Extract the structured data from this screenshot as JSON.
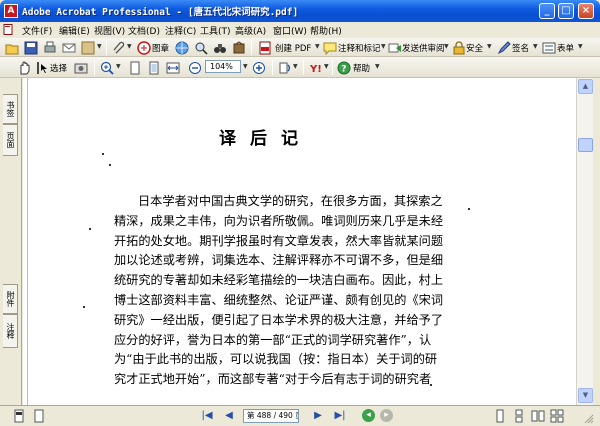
{
  "window": {
    "title": "Adobe Acrobat Professional - [唐五代北宋词研究.pdf]",
    "app_icon": "acrobat-icon"
  },
  "menu": {
    "items": [
      "文件(F)",
      "编辑(E)",
      "视图(V)",
      "文档(D)",
      "注释(C)",
      "工具(T)",
      "高级(A)",
      "窗口(W)",
      "帮助(H)"
    ]
  },
  "toolbar1": {
    "picture_label": "图章",
    "create_pdf": "创建 PDF",
    "comment_markup": "注释和标记",
    "send_review": "发送供审阅",
    "security": "安全",
    "sign": "签名",
    "forms": "表单"
  },
  "toolbar2": {
    "select_label": "选择",
    "zoom_value": "104%",
    "help_label": "帮助"
  },
  "leftnav": {
    "tabs_top": [
      "书签",
      "页面"
    ],
    "tabs_bottom": [
      "附件",
      "注释"
    ]
  },
  "document": {
    "title": "译后记",
    "lines": [
      "日本学者对中国古典文学的研究，在很多方面，其探索之",
      "精深，成果之丰伟，向为识者所敬佩。唯词则历来几乎是未经",
      "开拓的处女地。期刊学报虽时有文章发表，然大率皆就某问题",
      "加以论述或考辨，词集选本、注解评释亦不可谓不多，但是细",
      "统研究的专著却如未经彩笔描绘的一块洁白画布。因此，村上",
      "博士这部资料丰富、细统整然、论证严谨、颇有创见的《宋词",
      "研究》一经出版，便引起了日本学术界的极大注意，并给予了",
      "应分的好评，誉为日本的第一部“正式的词学研究著作”，认",
      "为“由于此书的出版，可以说我国（按：指日本）关于词的研",
      "究才正式地开始”，而这部专著“对于今后有志于词的研究者"
    ]
  },
  "statusbar": {
    "page_display": "第 488 / 490 页"
  },
  "colors": {
    "titlebar": "#0f5be0",
    "window_bg": "#ece9d8",
    "acrobat_red": "#c8161d"
  }
}
